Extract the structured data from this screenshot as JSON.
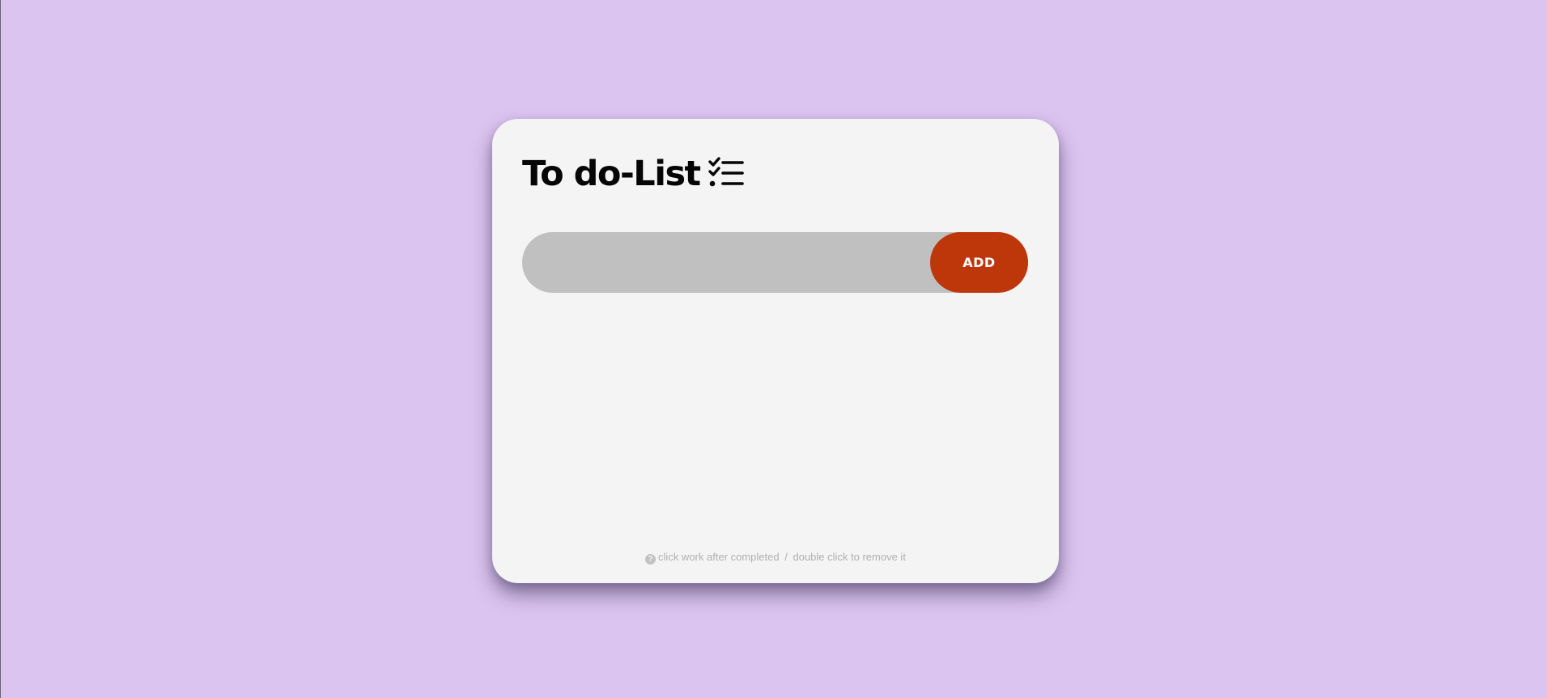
{
  "app": {
    "title": "To do-List",
    "title_icon": "checklist-icon",
    "colors": {
      "background": "#dbc4ef",
      "card": "#f4f4f4",
      "input": "#c0c0c0",
      "accent": "#bd370b"
    }
  },
  "form": {
    "input_value": "",
    "add_label": "ADD"
  },
  "tasks": [],
  "hint": {
    "icon": "question-circle-icon",
    "icon_glyph": "?",
    "part1": "click work after completed",
    "separator": "/",
    "part2": "double click to remove it"
  }
}
